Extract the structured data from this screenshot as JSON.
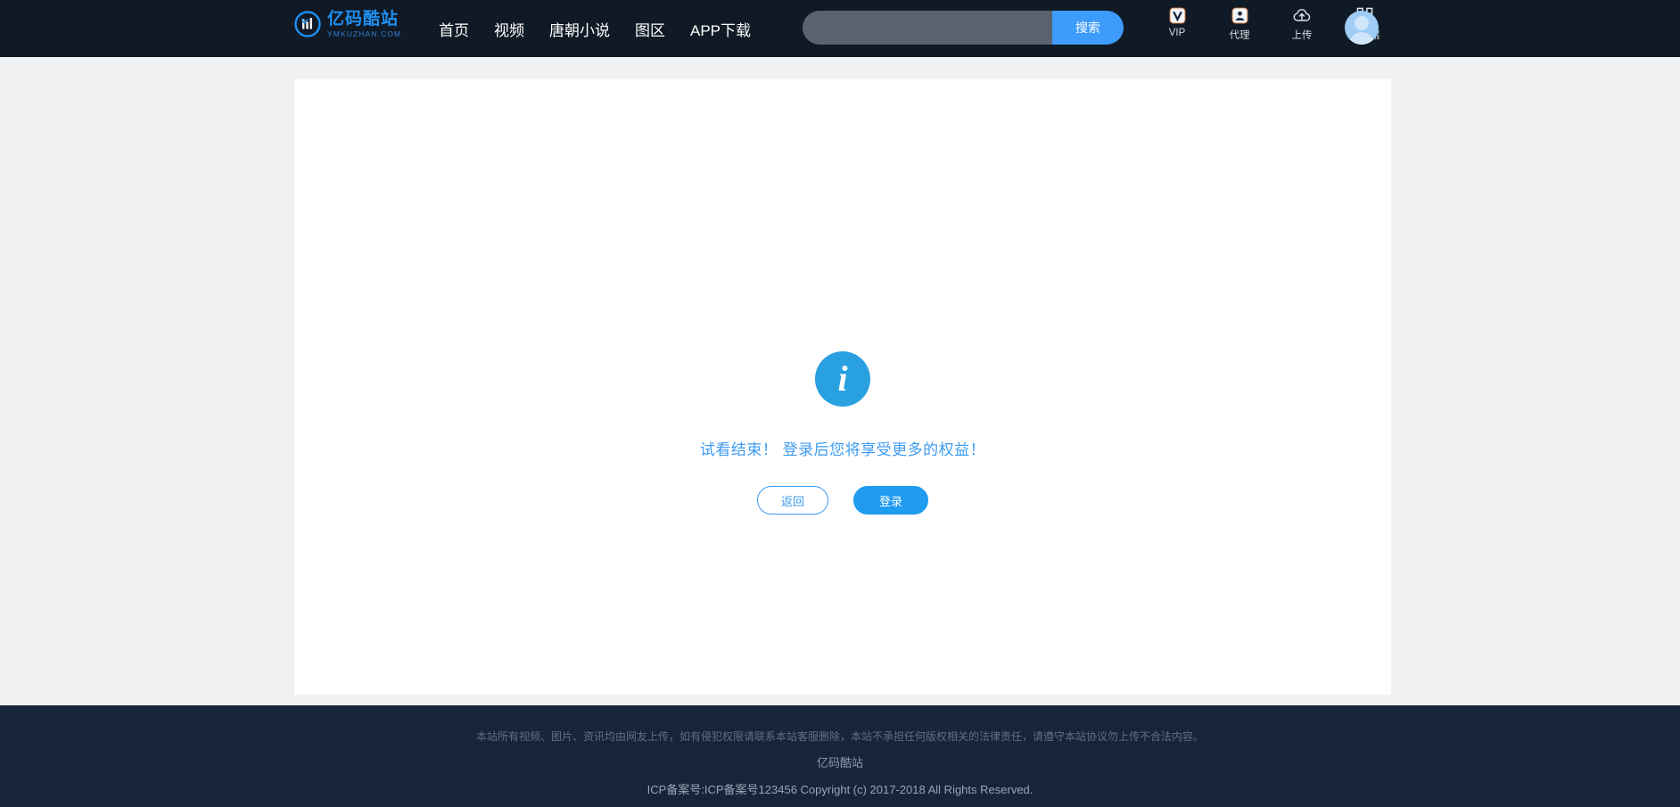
{
  "header": {
    "logo": {
      "icon": "ymkuzhan-circle-logo-icon",
      "cn": "亿码酷站",
      "en": "YMKUZHAN.COM"
    },
    "nav": [
      {
        "label": "首页"
      },
      {
        "label": "视频"
      },
      {
        "label": "唐朝小说"
      },
      {
        "label": "图区"
      },
      {
        "label": "APP下载"
      }
    ],
    "search": {
      "value": "",
      "placeholder": "",
      "button_label": "搜索"
    },
    "tools": [
      {
        "icon": "vip-badge-icon",
        "label": "VIP"
      },
      {
        "icon": "agent-person-icon",
        "label": "代理"
      },
      {
        "icon": "cloud-upload-icon",
        "label": "上传"
      },
      {
        "icon": "qr-code-icon",
        "label": "移动端"
      }
    ],
    "avatar": {
      "icon": "user-avatar-icon"
    }
  },
  "main": {
    "notice": {
      "icon": "info-circle-icon",
      "icon_glyph": "i",
      "text": "试看结束！ 登录后您将享受更多的权益！",
      "buttons": {
        "back": "返回",
        "login": "登录"
      }
    }
  },
  "footer": {
    "disclaimer": "本站所有视频、图片、资讯均由网友上传，如有侵犯权限请联系本站客服删除，本站不承担任何版权相关的法律责任，请遵守本站协议勿上传不合法内容。",
    "site_name": "亿码酷站",
    "copyright": "ICP备案号:ICP备案号123456  Copyright (c) 2017-2018 All Rights Reserved."
  },
  "colors": {
    "header_bg": "#101a26",
    "footer_bg": "#16253c",
    "page_bg": "#f0f1f3",
    "accent": "#3d9bfb",
    "info_blue": "#29a0e0"
  }
}
